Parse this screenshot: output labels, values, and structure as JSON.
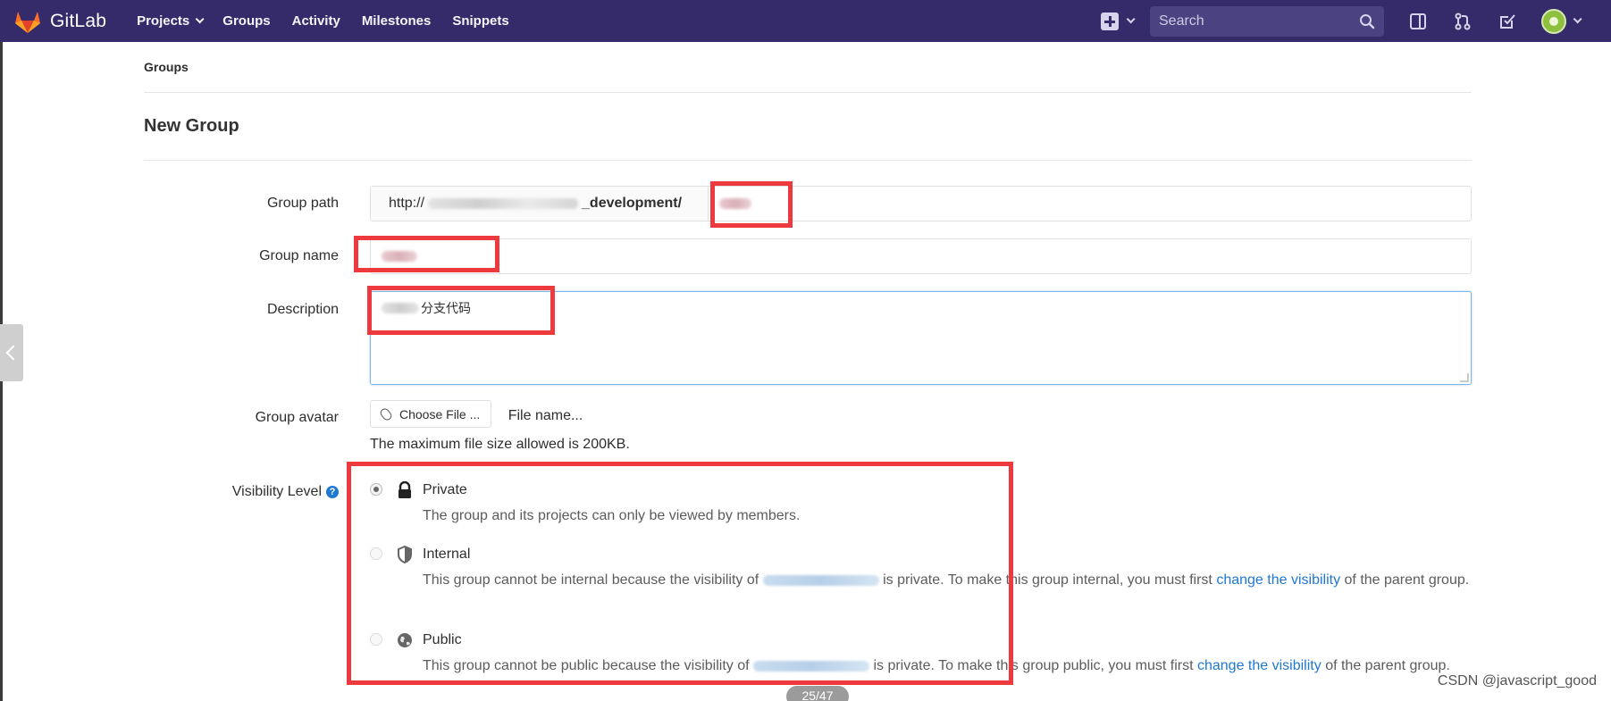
{
  "navbar": {
    "brand": "GitLab",
    "links": [
      "Projects",
      "Groups",
      "Activity",
      "Milestones",
      "Snippets"
    ],
    "search_placeholder": "Search",
    "colors": {
      "background": "#352b6b",
      "search_bg": "#4b4281"
    }
  },
  "breadcrumb": "Groups",
  "page_title": "New Group",
  "form": {
    "group_path": {
      "label": "Group path",
      "prefix_start": "http://",
      "prefix_end": "_development/"
    },
    "group_name": {
      "label": "Group name"
    },
    "description": {
      "label": "Description",
      "value_visible": "分支代码"
    },
    "group_avatar": {
      "label": "Group avatar",
      "choose_button": "Choose File ...",
      "file_name": "File name...",
      "hint": "The maximum file size allowed is 200KB."
    },
    "visibility": {
      "label": "Visibility Level",
      "help": "?",
      "options": [
        {
          "title": "Private",
          "icon": "lock-icon",
          "checked": true,
          "description": "The group and its projects can only be viewed by members."
        },
        {
          "title": "Internal",
          "icon": "shield-icon",
          "checked": false,
          "desc_start": "This group cannot be internal because the visibility of",
          "desc_mid": "is private. To make this group internal, you must first",
          "link": "change the visibility",
          "desc_end": "of the parent group."
        },
        {
          "title": "Public",
          "icon": "globe-icon",
          "checked": false,
          "desc_start": "This group cannot be public because the visibility of",
          "desc_mid": "is private. To make this group public, you must first",
          "link": "change the visibility",
          "desc_end": "of the parent group."
        }
      ]
    }
  },
  "page_indicator": "25/47",
  "watermark": "CSDN @javascript_good",
  "annotation_color": "#ee3a3f"
}
